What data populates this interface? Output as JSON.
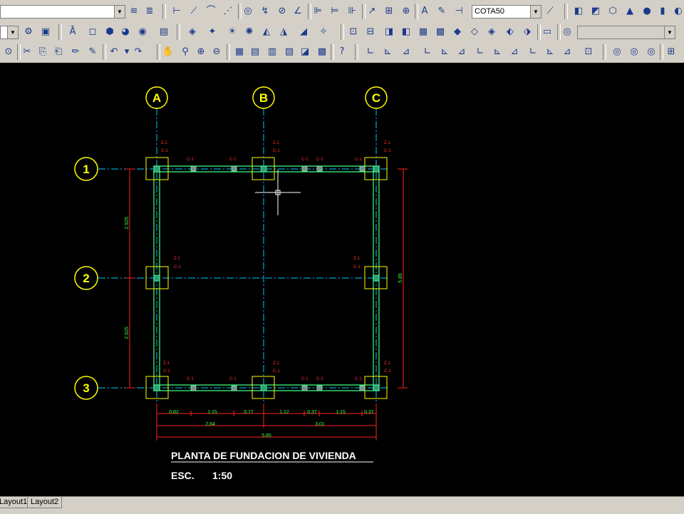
{
  "toolbar": {
    "dimstyle_combo": "COTA50",
    "layer_combo": "",
    "view_combo": ""
  },
  "layout_tabs": [
    "Layout1",
    "Layout2"
  ],
  "drawing": {
    "grid_cols": [
      "A",
      "B",
      "C"
    ],
    "grid_rows": [
      "1",
      "2",
      "3"
    ],
    "title": "PLANTA DE FUNDACION DE VIVIENDA",
    "scale_label": "ESC.",
    "scale_value": "1:50",
    "left_dims": [
      "2.925",
      "2.925"
    ],
    "right_dim": "5.85",
    "bottom_dims_row1": [
      "0.82",
      "1.15",
      "0.77",
      "1.12",
      "0.37",
      "1.15",
      "0.37"
    ],
    "bottom_dims_row2": [
      "2.84",
      "3.01"
    ],
    "bottom_dim_total": "5.85",
    "footing_label": "Z-1",
    "column_label": "C-1",
    "beam_label": "C-1"
  },
  "colors": {
    "grid_bubble": "#ffff00",
    "grid_axis": "#00c8ff",
    "beam": "#40ff80",
    "footing": "#ffff00",
    "dimension": "#ff2020",
    "dim_text": "#40ff40",
    "title_text": "#ffffff"
  }
}
